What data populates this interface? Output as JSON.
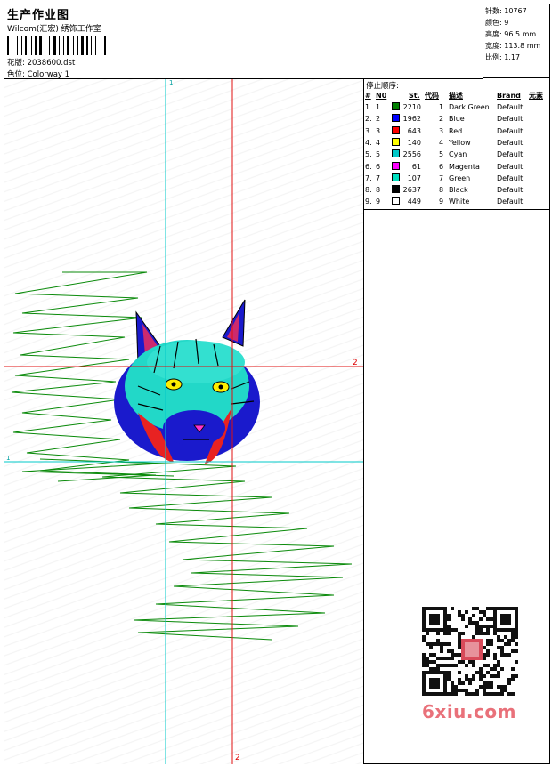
{
  "header": {
    "title": "生产作业图",
    "company": "Wilcom(汇宏) 绣饰工作室",
    "design_label": "花版:",
    "design_file": "2038600.dst",
    "colorway_label": "色位:",
    "colorway": "Colorway 1"
  },
  "stats": {
    "stitches_label": "针数:",
    "stitches": "10767",
    "colors_label": "颜色:",
    "colors": "9",
    "height_label": "高度:",
    "height": "96.5 mm",
    "width_label": "宽度:",
    "width": "113.8 mm",
    "ratio_label": "比例:",
    "ratio": "1.17"
  },
  "thread_table": {
    "title": "停止顺序:",
    "headers": {
      "hash": "#",
      "num": "N0",
      "stitches": "St.",
      "code": "代码",
      "description": "描述",
      "brand": "Brand",
      "element": "元素"
    },
    "rows": [
      {
        "idx": "1.",
        "n": "1",
        "st": "2210",
        "code": "1",
        "desc": "Dark Green",
        "brand": "Default",
        "color": "#008000"
      },
      {
        "idx": "2.",
        "n": "2",
        "st": "1962",
        "code": "2",
        "desc": "Blue",
        "brand": "Default",
        "color": "#0000ff"
      },
      {
        "idx": "3.",
        "n": "3",
        "st": "643",
        "code": "3",
        "desc": "Red",
        "brand": "Default",
        "color": "#ff0000"
      },
      {
        "idx": "4.",
        "n": "4",
        "st": "140",
        "code": "4",
        "desc": "Yellow",
        "brand": "Default",
        "color": "#ffff00"
      },
      {
        "idx": "5.",
        "n": "5",
        "st": "2556",
        "code": "5",
        "desc": "Cyan",
        "brand": "Default",
        "color": "#00c8c8"
      },
      {
        "idx": "6.",
        "n": "6",
        "st": "61",
        "code": "6",
        "desc": "Magenta",
        "brand": "Default",
        "color": "#ff00ff"
      },
      {
        "idx": "7.",
        "n": "7",
        "st": "107",
        "code": "7",
        "desc": "Green",
        "brand": "Default",
        "color": "#00e0c0"
      },
      {
        "idx": "8.",
        "n": "8",
        "st": "2637",
        "code": "8",
        "desc": "Black",
        "brand": "Default",
        "color": "#000000"
      },
      {
        "idx": "9.",
        "n": "9",
        "st": "449",
        "code": "9",
        "desc": "White",
        "brand": "Default",
        "color": "#ffffff"
      }
    ]
  },
  "guides": {
    "marker_1": "1",
    "marker_2": "2"
  },
  "watermark": "6xiu.com"
}
